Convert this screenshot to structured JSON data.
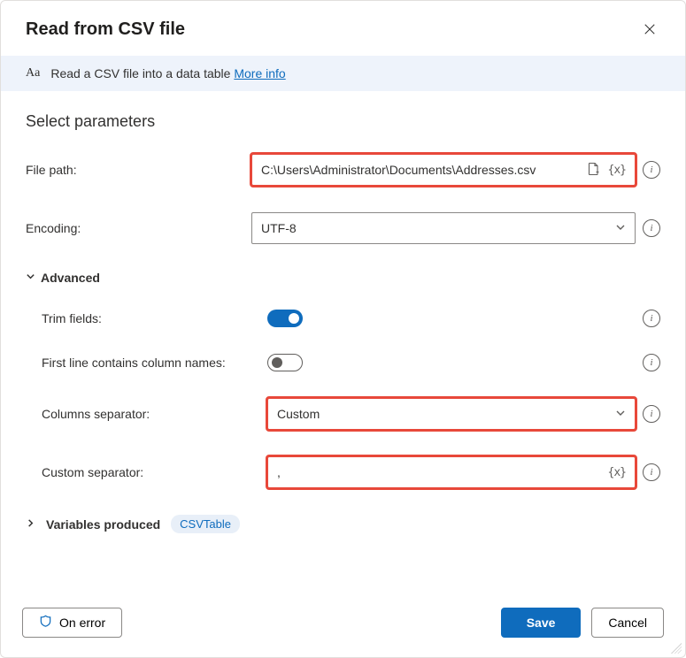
{
  "dialog": {
    "title": "Read from CSV file",
    "banner_text": "Read a CSV file into a data table ",
    "more_info": "More info"
  },
  "section_title": "Select parameters",
  "fields": {
    "file_path": {
      "label": "File path:",
      "value": "C:\\Users\\Administrator\\Documents\\Addresses.csv"
    },
    "encoding": {
      "label": "Encoding:",
      "value": "UTF-8"
    }
  },
  "advanced": {
    "header": "Advanced",
    "trim": {
      "label": "Trim fields:",
      "on": true
    },
    "first_line": {
      "label": "First line contains column names:",
      "on": false
    },
    "separator": {
      "label": "Columns separator:",
      "value": "Custom"
    },
    "custom_sep": {
      "label": "Custom separator:",
      "value": ","
    }
  },
  "variables": {
    "label": "Variables produced",
    "pill": "CSVTable"
  },
  "footer": {
    "on_error": "On error",
    "save": "Save",
    "cancel": "Cancel"
  },
  "glyphs": {
    "varx": "{x}"
  }
}
